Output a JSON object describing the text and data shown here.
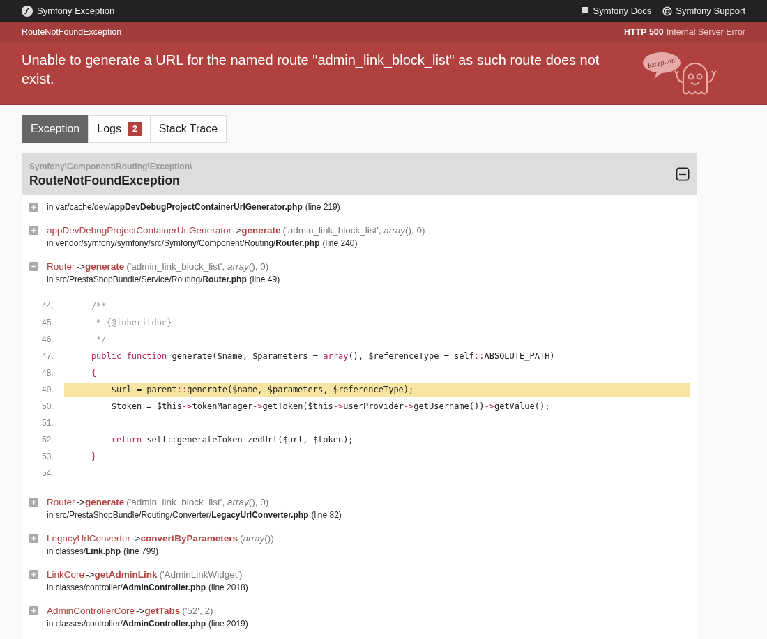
{
  "top_bar": {
    "title": "Symfony Exception",
    "links": [
      {
        "kind": "docs",
        "label": "Symfony Docs"
      },
      {
        "kind": "support",
        "label": "Symfony Support"
      }
    ]
  },
  "status_bar": {
    "exception_class": "RouteNotFoundException",
    "status_code": "HTTP 500",
    "status_text": "Internal Server Error"
  },
  "message": "Unable to generate a URL for the named route \"admin_link_block_list\" as such route does not exist.",
  "mascot_bubble": "Exception!",
  "tabs": [
    {
      "label": "Exception",
      "selected": true
    },
    {
      "label": "Logs",
      "badge": "2",
      "selected": false
    },
    {
      "label": "Stack Trace",
      "selected": false
    }
  ],
  "exception": {
    "namespace": "Symfony\\Component\\Routing\\Exception\\",
    "class": "RouteNotFoundException",
    "expanded": true,
    "trace": [
      {
        "expanded": false,
        "file_dir": "in var/cache/dev/",
        "file_name": "appDevDebugProjectContainerUrlGenerator.php",
        "line": "(line 219)"
      },
      {
        "expanded": false,
        "class": "appDevDebugProjectContainerUrlGenerator",
        "arrow": "->",
        "method": "generate",
        "args": "('admin_link_block_list', *array*(), 0)",
        "file_dir": "in vendor/symfony/symfony/src/Symfony/Component/Routing/",
        "file_name": "Router.php",
        "line": "(line 240)"
      },
      {
        "expanded": true,
        "class": "Router",
        "arrow": "->",
        "method": "generate",
        "args": "('admin_link_block_list', *array*(), 0)",
        "file_dir": "in src/PrestaShopBundle/Service/Routing/",
        "file_name": "Router.php",
        "line": "(line 49)",
        "code": [
          {
            "number": "44.",
            "highlighted": false,
            "tokens": [
              {
                "kind": "comment",
                "text": "    /**"
              }
            ]
          },
          {
            "number": "45.",
            "highlighted": false,
            "tokens": [
              {
                "kind": "comment",
                "text": "     * {@inheritdoc}"
              }
            ]
          },
          {
            "number": "46.",
            "highlighted": false,
            "tokens": [
              {
                "kind": "comment",
                "text": "     */"
              }
            ]
          },
          {
            "number": "47.",
            "highlighted": false,
            "tokens": [
              {
                "kind": "keyword",
                "text": "    public function "
              },
              {
                "kind": "plain",
                "text": "generate($name, $parameters = "
              },
              {
                "kind": "keyword",
                "text": "array"
              },
              {
                "kind": "plain",
                "text": "(), $referenceType = self"
              },
              {
                "kind": "keyword",
                "text": "::"
              },
              {
                "kind": "plain",
                "text": "ABSOLUTE_PATH)"
              }
            ]
          },
          {
            "number": "48.",
            "highlighted": false,
            "tokens": [
              {
                "kind": "keyword",
                "text": "    {"
              }
            ]
          },
          {
            "number": "49.",
            "highlighted": true,
            "tokens": [
              {
                "kind": "plain",
                "text": "        $url = parent"
              },
              {
                "kind": "keyword",
                "text": "::"
              },
              {
                "kind": "plain",
                "text": "generate($name, $parameters, $referenceType);"
              }
            ]
          },
          {
            "number": "50.",
            "highlighted": false,
            "tokens": [
              {
                "kind": "plain",
                "text": "        $token = $this"
              },
              {
                "kind": "keyword",
                "text": "->"
              },
              {
                "kind": "plain",
                "text": "tokenManager"
              },
              {
                "kind": "keyword",
                "text": "->"
              },
              {
                "kind": "plain",
                "text": "getToken($this"
              },
              {
                "kind": "keyword",
                "text": "->"
              },
              {
                "kind": "plain",
                "text": "userProvider"
              },
              {
                "kind": "keyword",
                "text": "->"
              },
              {
                "kind": "plain",
                "text": "getUsername())"
              },
              {
                "kind": "keyword",
                "text": "->"
              },
              {
                "kind": "plain",
                "text": "getValue();"
              }
            ]
          },
          {
            "number": "51.",
            "highlighted": false
          },
          {
            "number": "52.",
            "highlighted": false,
            "tokens": [
              {
                "kind": "keyword",
                "text": "        return "
              },
              {
                "kind": "plain",
                "text": "self"
              },
              {
                "kind": "keyword",
                "text": "::"
              },
              {
                "kind": "plain",
                "text": "generateTokenizedUrl($url, $token);"
              }
            ]
          },
          {
            "number": "53.",
            "highlighted": false,
            "tokens": [
              {
                "kind": "keyword",
                "text": "    }"
              }
            ]
          },
          {
            "number": "54.",
            "highlighted": false
          }
        ]
      },
      {
        "expanded": false,
        "class": "Router",
        "arrow": "->",
        "method": "generate",
        "args": "('admin_link_block_list', *array*(), 0)",
        "file_dir": "in src/PrestaShopBundle/Routing/Converter/",
        "file_name": "LegacyUrlConverter.php",
        "line": "(line 82)"
      },
      {
        "expanded": false,
        "class": "LegacyUrlConverter",
        "arrow": "->",
        "method": "convertByParameters",
        "args": "(*array*())",
        "file_dir": "in classes/",
        "file_name": "Link.php",
        "line": "(line 799)"
      },
      {
        "expanded": false,
        "class": "LinkCore",
        "arrow": "->",
        "method": "getAdminLink",
        "args": "('AdminLinkWidget')",
        "file_dir": "in classes/controller/",
        "file_name": "AdminController.php",
        "line": "(line 2018)"
      },
      {
        "expanded": false,
        "class": "AdminControllerCore",
        "arrow": "->",
        "method": "getTabs",
        "args": "('52', 2)",
        "file_dir": "in classes/controller/",
        "file_name": "AdminController.php",
        "line": "(line 2019)"
      }
    ]
  }
}
